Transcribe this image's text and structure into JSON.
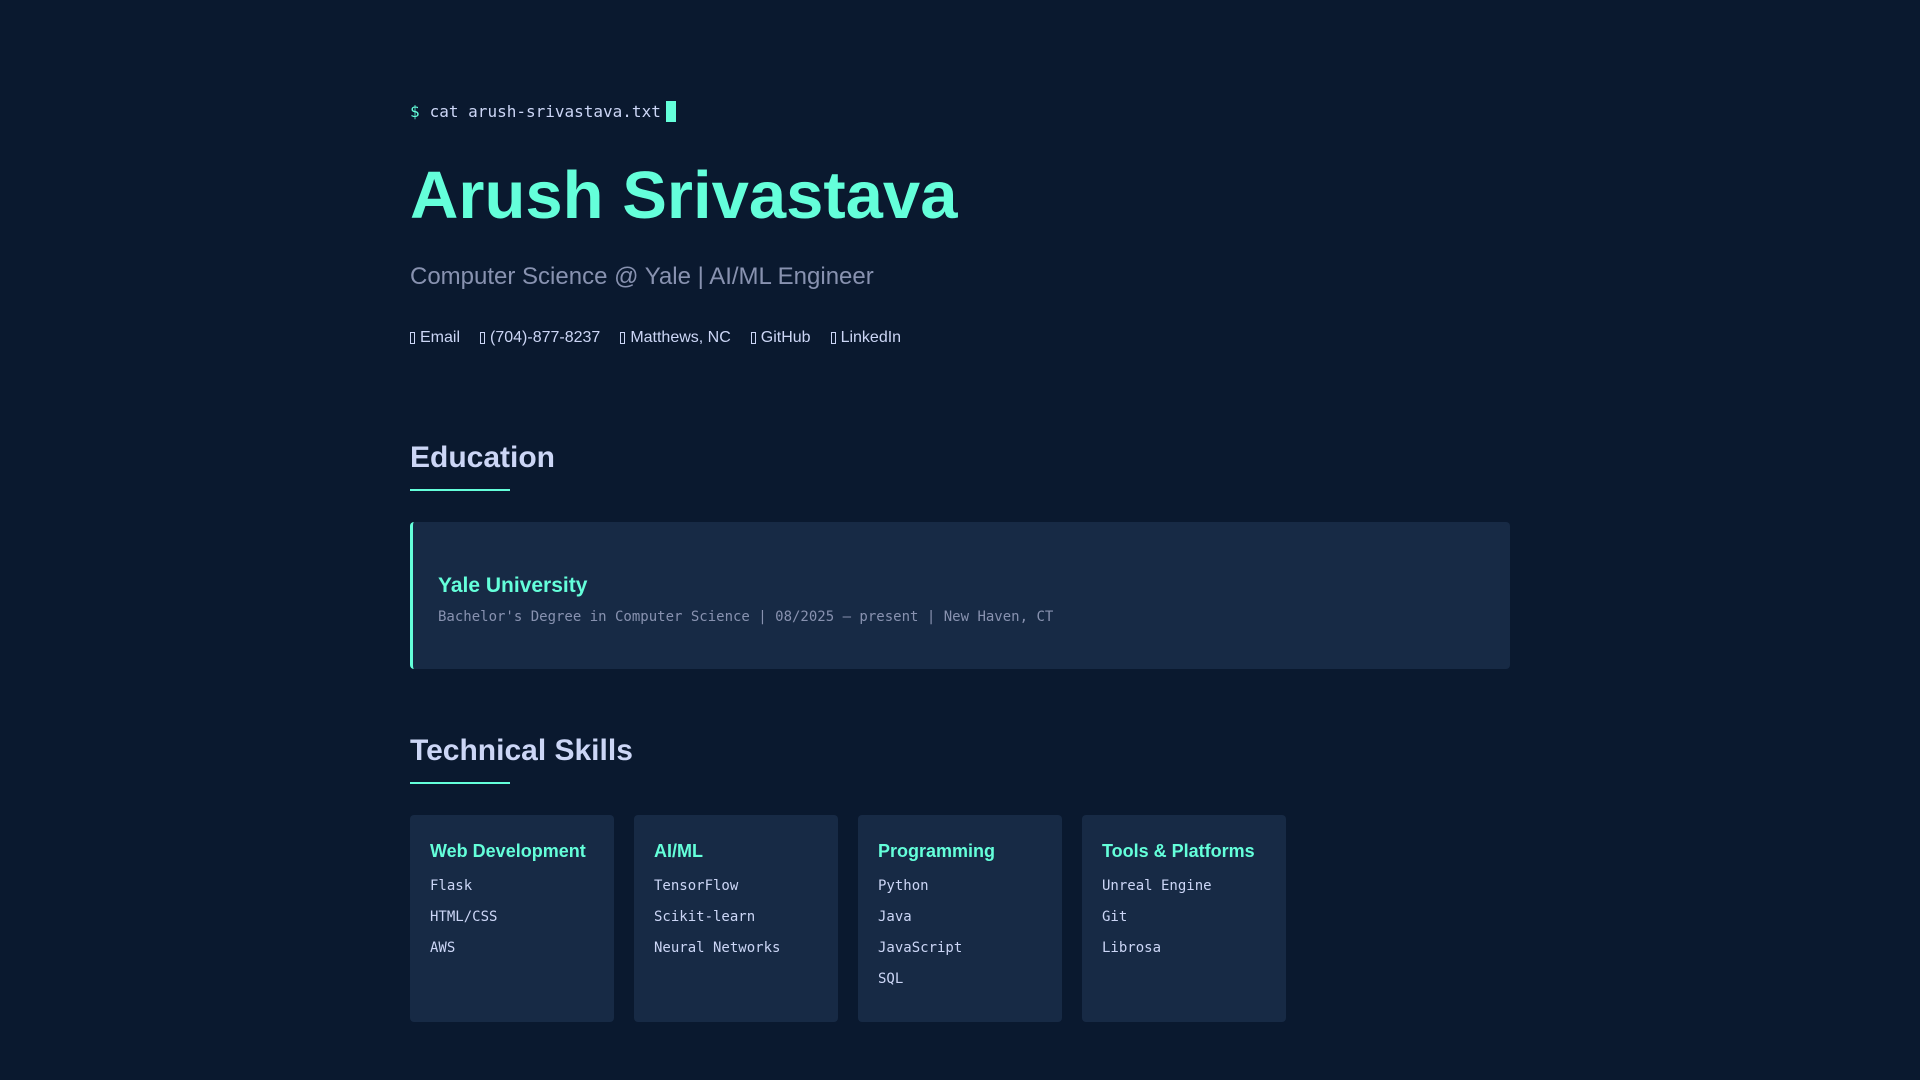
{
  "terminal": {
    "prompt": "$",
    "command": "cat arush-srivastava.txt"
  },
  "header": {
    "name": "Arush Srivastava",
    "subtitle": "Computer Science @ Yale | AI/ML Engineer"
  },
  "contacts": [
    {
      "icon": "envelope-icon",
      "label": "Email"
    },
    {
      "icon": "phone-icon",
      "label": "(704)-877-8237"
    },
    {
      "icon": "location-pin-icon",
      "label": "Matthews, NC"
    },
    {
      "icon": "github-icon",
      "label": "GitHub"
    },
    {
      "icon": "linkedin-icon",
      "label": "LinkedIn"
    }
  ],
  "education": {
    "title": "Education",
    "school": "Yale University",
    "details": "Bachelor's Degree in Computer Science | 08/2025 – present | New Haven, CT"
  },
  "skills": {
    "title": "Technical Skills",
    "categories": [
      {
        "title": "Web Development",
        "items": [
          "Flask",
          "HTML/CSS",
          "AWS"
        ]
      },
      {
        "title": "AI/ML",
        "items": [
          "TensorFlow",
          "Scikit-learn",
          "Neural Networks"
        ]
      },
      {
        "title": "Programming",
        "items": [
          "Python",
          "Java",
          "JavaScript",
          "SQL"
        ]
      },
      {
        "title": "Tools & Platforms",
        "items": [
          "Unreal Engine",
          "Git",
          "Librosa"
        ]
      }
    ]
  },
  "colors": {
    "background": "#0a192f",
    "accent": "#64ffda",
    "card": "#172a45",
    "text": "#ccd6f6",
    "muted": "#8892b0"
  }
}
